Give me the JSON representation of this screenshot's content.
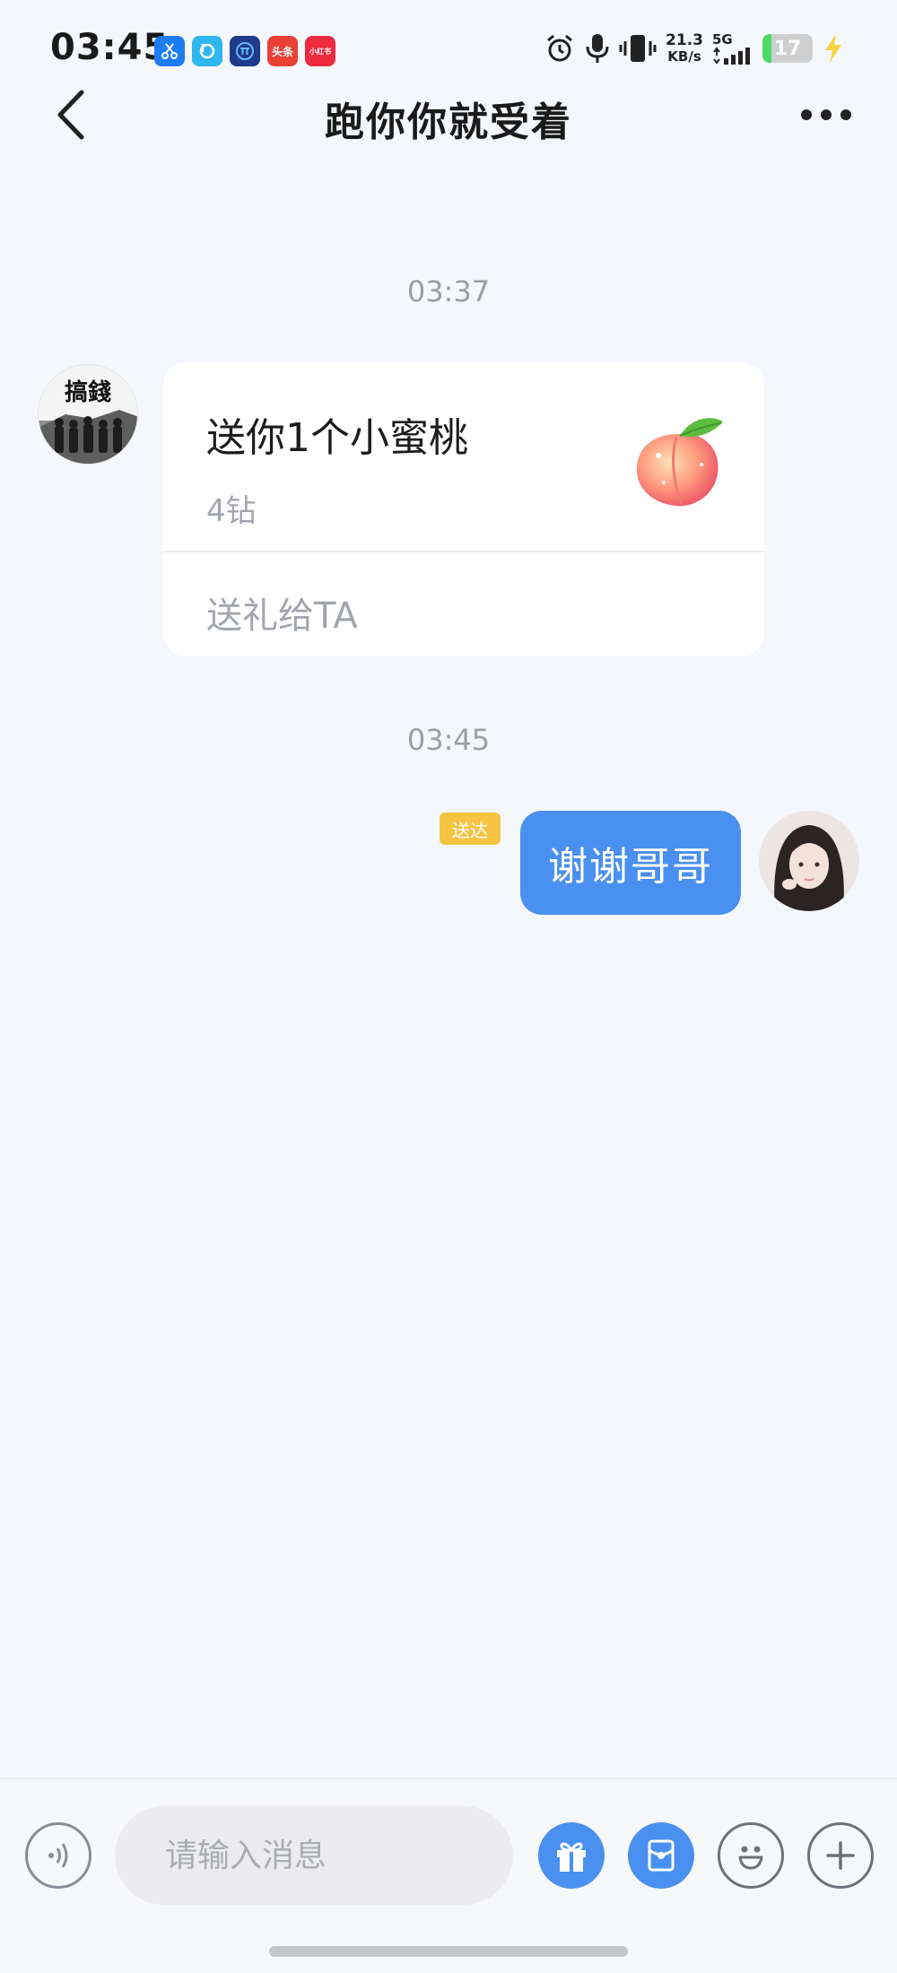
{
  "status_bar": {
    "time": "03:45",
    "app_icons": [
      {
        "name": "scissors-app-icon",
        "color": "#1e7cf2",
        "label": ""
      },
      {
        "name": "bubble-app-icon",
        "color": "#2fb7f0",
        "label": ""
      },
      {
        "name": "tt-app-icon",
        "color": "#1f3a8a",
        "label": ""
      },
      {
        "name": "toutiao-app-icon",
        "color": "#e94035",
        "label": "头条"
      },
      {
        "name": "xiaohongshu-app-icon",
        "color": "#ee2a41",
        "label": "小红书"
      }
    ],
    "net_speed_value": "21.3",
    "net_speed_unit": "KB/s",
    "network": "5G",
    "battery_level": "17",
    "battery_fraction": 0.17
  },
  "header": {
    "title": "跑你你就受着"
  },
  "messages": {
    "time_1": "03:37",
    "gift": {
      "title": "送你1个小蜜桃",
      "price": "4钻",
      "action": "送礼给TA"
    },
    "incoming_avatar_text": "搞錢",
    "time_2": "03:45",
    "outgoing": {
      "status": "送达",
      "text": "谢谢哥哥"
    }
  },
  "input_bar": {
    "placeholder": "请输入消息"
  },
  "colors": {
    "accent": "#4a90f0",
    "background": "#f4f7fb",
    "delivered_badge": "#f6c343"
  }
}
